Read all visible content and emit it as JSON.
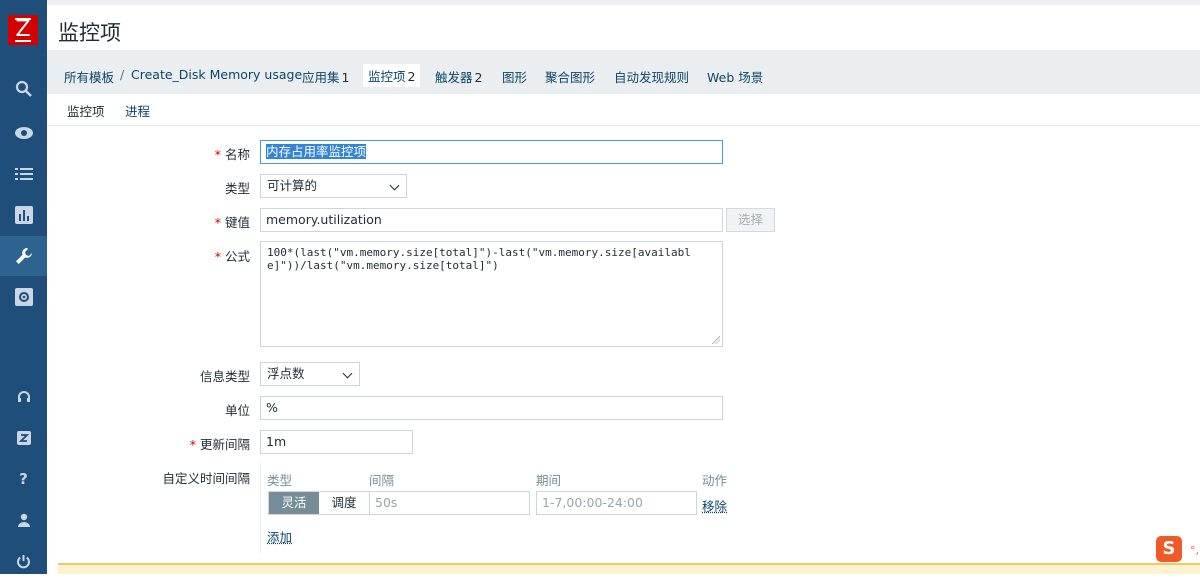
{
  "app": {
    "logo_letter": "Z",
    "page_title": "监控项"
  },
  "sidebar": {
    "items": [
      {
        "name": "search-icon"
      },
      {
        "name": "eye-icon"
      },
      {
        "name": "list-icon"
      },
      {
        "name": "chart-icon"
      },
      {
        "name": "wrench-icon"
      },
      {
        "name": "cog-icon"
      },
      {
        "name": "support-icon"
      },
      {
        "name": "share-icon"
      },
      {
        "name": "help-icon"
      },
      {
        "name": "user-icon"
      },
      {
        "name": "power-icon"
      }
    ],
    "help_glyph": "?"
  },
  "breadcrumb": {
    "all_templates": "所有模板",
    "separator": "/",
    "template_name": "Create_Disk Memory usage",
    "tabs": [
      {
        "label": "应用集",
        "count": "1"
      },
      {
        "label": "监控项",
        "count": "2"
      },
      {
        "label": "触发器",
        "count": "2"
      },
      {
        "label": "图形",
        "count": ""
      },
      {
        "label": "聚合图形",
        "count": ""
      },
      {
        "label": "自动发现规则",
        "count": ""
      },
      {
        "label": "Web 场景",
        "count": ""
      }
    ]
  },
  "subtabs": {
    "item": "监控项",
    "process": "进程"
  },
  "form": {
    "name_label": "名称",
    "name_value": "内存占用率监控项",
    "type_label": "类型",
    "type_value": "可计算的",
    "key_label": "键值",
    "key_value": "memory.utilization",
    "select_button": "选择",
    "formula_label": "公式",
    "formula_value": "100*(last(\"vm.memory.size[total]\")-last(\"vm.memory.size[available]\"))/last(\"vm.memory.size[total]\")",
    "info_type_label": "信息类型",
    "info_type_value": "浮点数",
    "units_label": "单位",
    "units_value": "%",
    "interval_label": "更新间隔",
    "interval_value": "1m",
    "custom_label": "自定义时间间隔"
  },
  "custom_intervals": {
    "headers": {
      "type": "类型",
      "interval": "间隔",
      "period": "期间",
      "action": "动作"
    },
    "type_flexible": "灵活",
    "type_scheduling": "调度",
    "interval_placeholder": "50s",
    "period_placeholder": "1-7,00:00-24:00",
    "remove": "移除",
    "add": "添加"
  },
  "ime": {
    "badge": "S",
    "dot": "°,"
  }
}
